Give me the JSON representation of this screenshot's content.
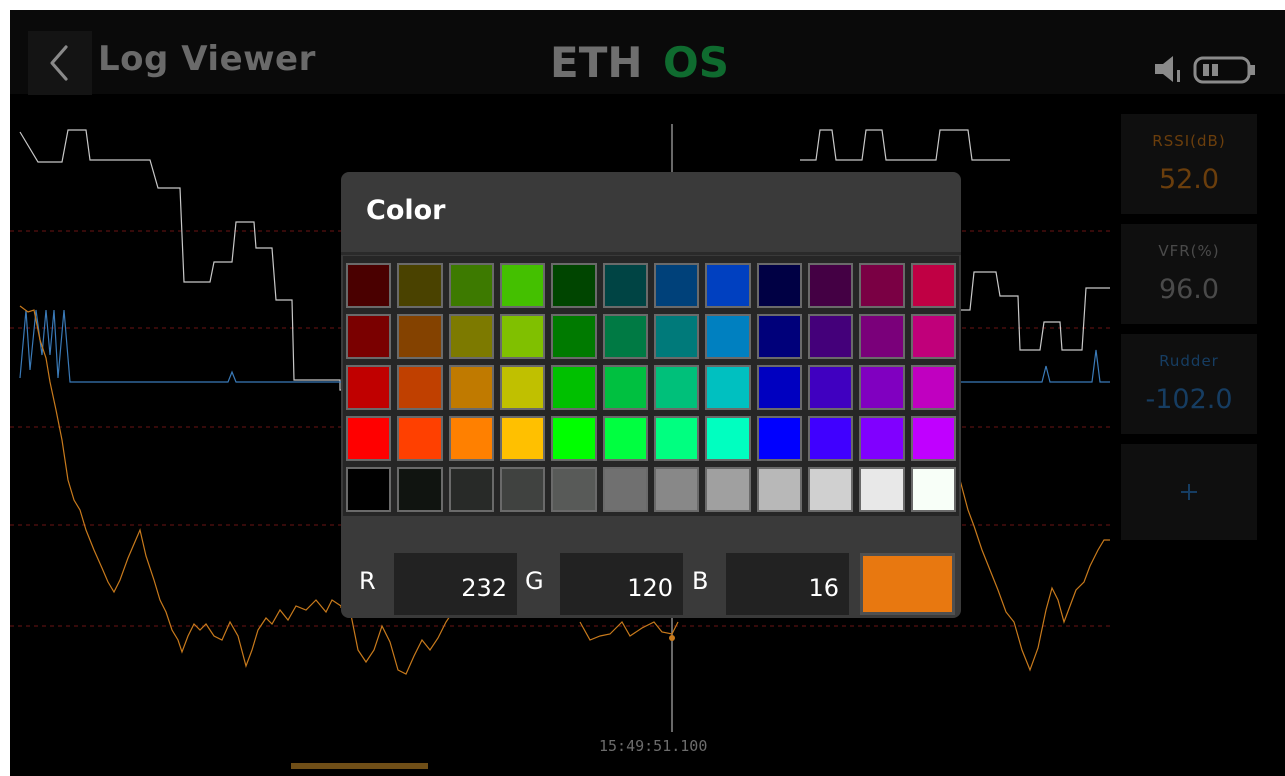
{
  "header": {
    "title": "Log Viewer",
    "logo": {
      "left_text": "ETH",
      "right_text": "OS",
      "left_color": "#6f6f6f",
      "right_color": "#0f6b2f"
    },
    "icons": [
      "chevron-left-icon",
      "speaker-icon",
      "battery-icon"
    ]
  },
  "sensors": [
    {
      "name": "RSSI(dB)",
      "value": "52.0",
      "color": "#6b3e0c",
      "name_color": "#6b3e0c"
    },
    {
      "name": "VFR(%)",
      "value": "96.0",
      "color": "#4a4a4a",
      "name_color": "#4a4a4a"
    },
    {
      "name": "Rudder",
      "value": "-102.0",
      "color": "#163d62",
      "name_color": "#163d62"
    }
  ],
  "add_sensor": {
    "label": "+"
  },
  "cursor_time": "15:49:51.100",
  "color_dialog": {
    "title": "Color",
    "palette": [
      [
        "#4a0000",
        "#4a4200",
        "#3d7a00",
        "#44c000",
        "#004500",
        "#004444",
        "#00417a",
        "#0040c0",
        "#000044",
        "#440044",
        "#7a0044",
        "#c00044"
      ],
      [
        "#7a0000",
        "#844200",
        "#7d7a00",
        "#80c000",
        "#007a00",
        "#007a44",
        "#007a7a",
        "#0080c0",
        "#00007a",
        "#44007a",
        "#7a007a",
        "#c0007a"
      ],
      [
        "#c00000",
        "#c04000",
        "#c07a00",
        "#c0c000",
        "#00c000",
        "#00c040",
        "#00c07a",
        "#00c0c0",
        "#0000c0",
        "#4000c0",
        "#8000c0",
        "#c000c0"
      ],
      [
        "#ff0000",
        "#ff4000",
        "#ff8000",
        "#ffc000",
        "#00ff00",
        "#00ff40",
        "#00ff80",
        "#00ffc0",
        "#0000ff",
        "#4000ff",
        "#8000ff",
        "#c000ff"
      ],
      [
        "#000000",
        "#101410",
        "#282a28",
        "#404240",
        "#585a58",
        "#707070",
        "#888888",
        "#a0a0a0",
        "#b8b8b8",
        "#d0d0d0",
        "#e8e8e8",
        "#f8fff8"
      ]
    ],
    "rgb": {
      "r_label": "R",
      "r_value": "232",
      "g_label": "G",
      "g_value": "120",
      "b_label": "B",
      "b_value": "16"
    },
    "preview_color": "#e87810"
  },
  "colors": {
    "background": "#000000",
    "dialog_bg": "#3a3a3a",
    "rssi_trace": "#c87a1c",
    "vfr_trace": "#c8c8c8",
    "rudder_trace": "#3a7ab8"
  }
}
